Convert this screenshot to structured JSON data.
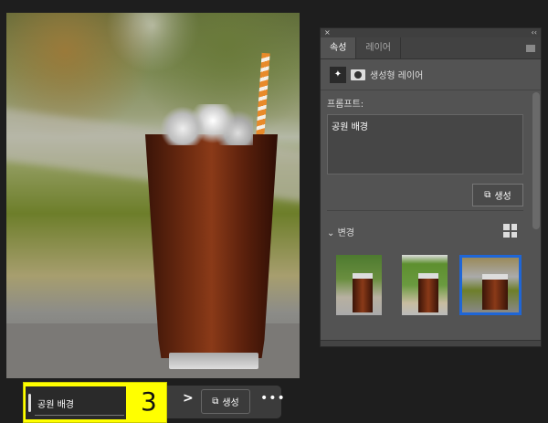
{
  "panel": {
    "close": "×",
    "collapse": "‹‹",
    "tabs": [
      "속성",
      "레이어"
    ],
    "layer_type": "생성형 레이어",
    "prompt_label": "프롬프트:",
    "prompt_value": "공원 배경",
    "generate": "생성",
    "variations_label": "변경",
    "variations_count": 3,
    "selected_variation": 3
  },
  "taskbar": {
    "prompt_value": "공원 배경",
    "overlay_number": "3",
    "next": ">",
    "generate": "생성",
    "more": "•••"
  },
  "colors": {
    "selection": "#1f66d6",
    "highlight": "#ffff00"
  }
}
